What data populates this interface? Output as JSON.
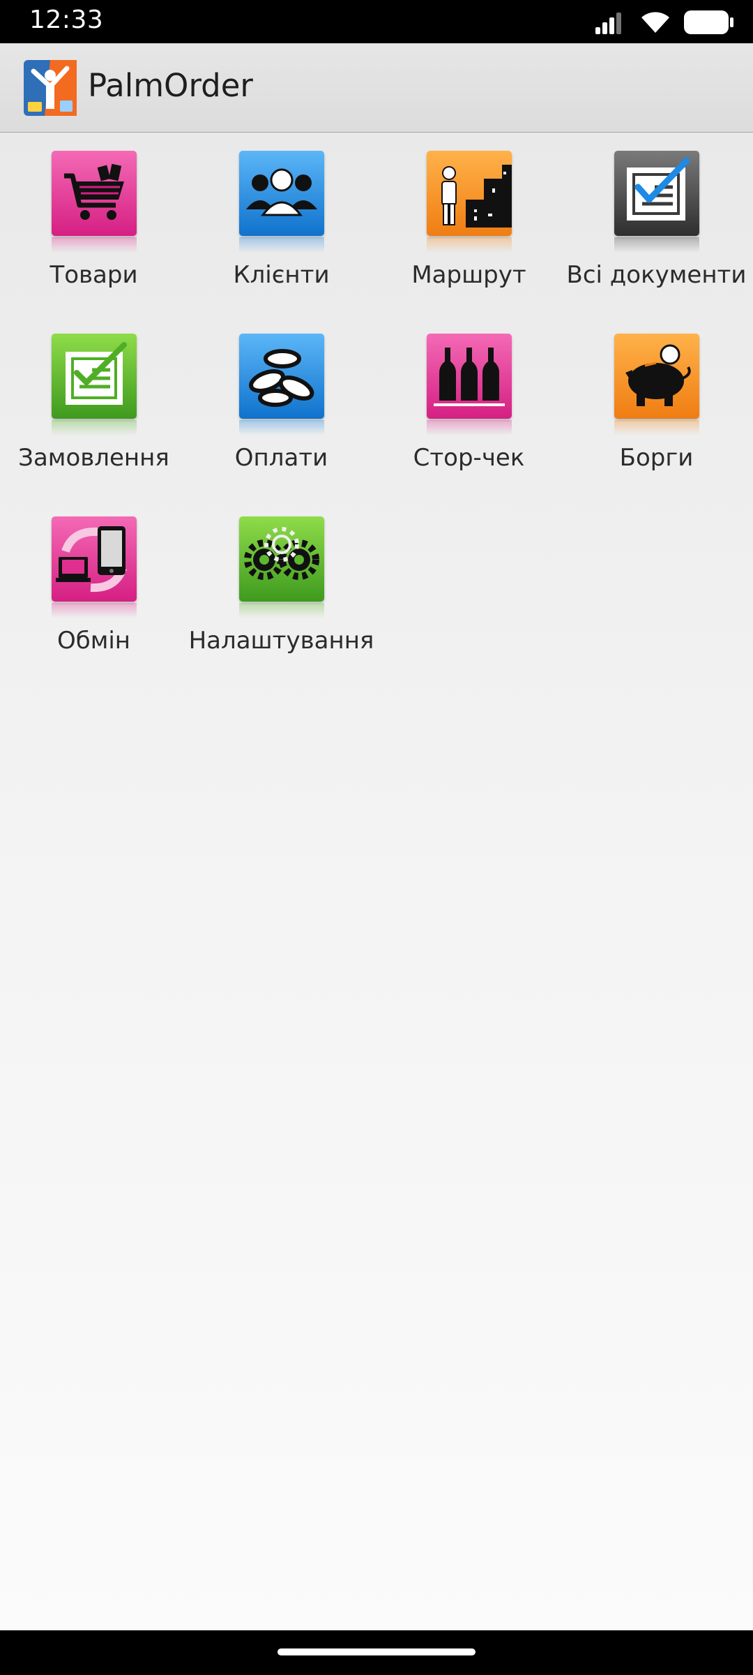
{
  "status_bar": {
    "time": "12:33",
    "icons": [
      "signal-icon",
      "wifi-icon",
      "battery-icon"
    ]
  },
  "app_bar": {
    "title": "PalmOrder",
    "logo_icon": "palmorder-logo-icon"
  },
  "menu": {
    "items": [
      {
        "label": "Товари",
        "icon": "shopping-cart-icon",
        "color": "#e0308f"
      },
      {
        "label": "Клієнти",
        "icon": "clients-icon",
        "color": "#1c86e0"
      },
      {
        "label": "Маршрут",
        "icon": "route-icon",
        "color": "#f58a1f"
      },
      {
        "label": "Всі документи",
        "icon": "all-documents-icon",
        "color": "#4a4a4a"
      },
      {
        "label": "Замовлення",
        "icon": "orders-icon",
        "color": "#5cb82c"
      },
      {
        "label": "Оплати",
        "icon": "payments-icon",
        "color": "#1c86e0"
      },
      {
        "label": "Стор-чек",
        "icon": "bottles-icon",
        "color": "#e0308f"
      },
      {
        "label": "Борги",
        "icon": "piggy-bank-icon",
        "color": "#f58a1f"
      },
      {
        "label": "Обмін",
        "icon": "exchange-icon",
        "color": "#e0308f"
      },
      {
        "label": "Налаштування",
        "icon": "settings-gears-icon",
        "color": "#5cb82c"
      }
    ]
  }
}
